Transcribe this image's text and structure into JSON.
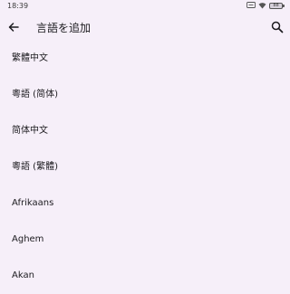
{
  "status_bar": {
    "time": "18:39",
    "battery_level": "88",
    "icons": [
      "notification-icon",
      "wifi-icon",
      "battery-icon"
    ]
  },
  "app_bar": {
    "title": "言語を追加",
    "back_icon": "arrow-back-icon",
    "search_icon": "search-icon"
  },
  "languages": [
    "繁體中文",
    "粵語 (简体)",
    "简体中文",
    "粵語 (繁體)",
    "Afrikaans",
    "Aghem",
    "Akan"
  ],
  "colors": {
    "background": "#f6eff9",
    "text": "#1c1b1f"
  }
}
